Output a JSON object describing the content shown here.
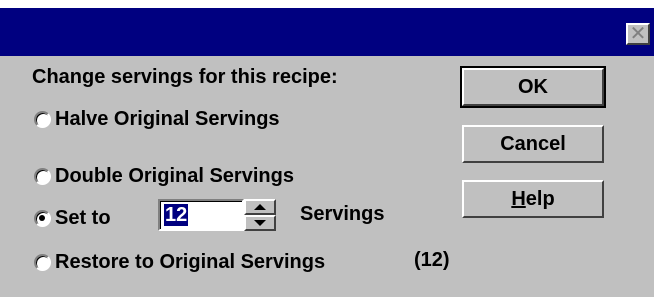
{
  "dialog": {
    "close_glyph": "✕",
    "prompt": "Change servings for this recipe:",
    "options": [
      {
        "label": "Halve Original Servings",
        "selected": false
      },
      {
        "label": "Double Original Servings",
        "selected": false
      },
      {
        "label": "Set to",
        "selected": true
      },
      {
        "label": "Restore to Original Servings",
        "selected": false
      }
    ],
    "set_to_value": "12",
    "servings_label": "Servings",
    "original_count": "(12)",
    "buttons": {
      "ok": "OK",
      "cancel": "Cancel",
      "help": "Help"
    }
  }
}
